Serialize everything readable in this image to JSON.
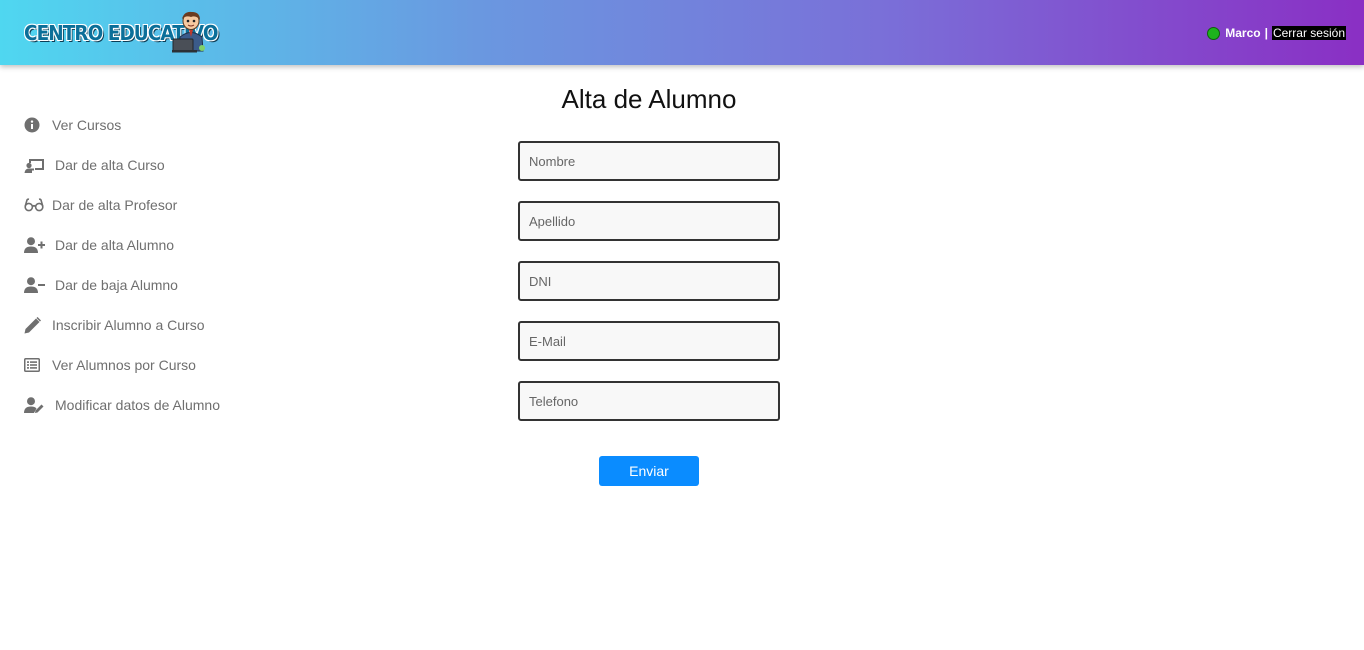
{
  "header": {
    "logo_text": "CENTRO EDUCATIVO",
    "user_name": "Marco",
    "separator": "|",
    "logout_label": "Cerrar sesión",
    "status_color": "#1db31d"
  },
  "sidebar": {
    "items": [
      {
        "label": "Ver Cursos",
        "icon": "info-circle-icon"
      },
      {
        "label": "Dar de alta Curso",
        "icon": "chalkboard-teacher-icon"
      },
      {
        "label": "Dar de alta Profesor",
        "icon": "glasses-icon"
      },
      {
        "label": "Dar de alta Alumno",
        "icon": "user-plus-icon"
      },
      {
        "label": "Dar de baja Alumno",
        "icon": "user-minus-icon"
      },
      {
        "label": "Inscribir Alumno a Curso",
        "icon": "pencil-icon"
      },
      {
        "label": "Ver Alumnos por Curso",
        "icon": "list-icon"
      },
      {
        "label": "Modificar datos de Alumno",
        "icon": "user-edit-icon"
      }
    ]
  },
  "main": {
    "title": "Alta de Alumno",
    "fields": [
      {
        "placeholder": "Nombre",
        "value": ""
      },
      {
        "placeholder": "Apellido",
        "value": ""
      },
      {
        "placeholder": "DNI",
        "value": ""
      },
      {
        "placeholder": "E-Mail",
        "value": ""
      },
      {
        "placeholder": "Telefono",
        "value": ""
      }
    ],
    "submit_label": "Enviar",
    "accent_color": "#0a8cff"
  }
}
